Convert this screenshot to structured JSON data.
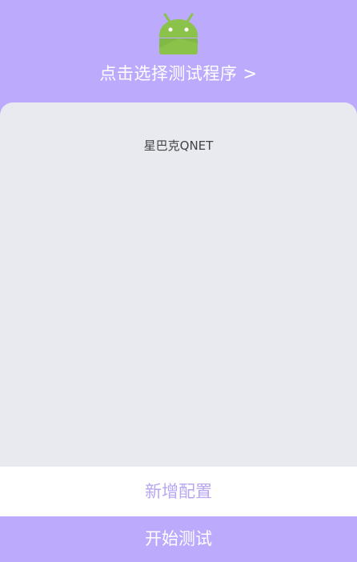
{
  "header": {
    "app_icon": "android-robot-icon",
    "select_app_label": "点击选择测试程序 >"
  },
  "config_list": {
    "items": [
      {
        "label": "星巴克QNET"
      }
    ]
  },
  "actions": {
    "add_config_label": "新增配置",
    "start_test_label": "开始测试"
  },
  "colors": {
    "accent": "#bcaafc",
    "content_bg": "#e9eaef",
    "add_button_text": "#b8a6f2",
    "android_green": "#8bc34a"
  }
}
